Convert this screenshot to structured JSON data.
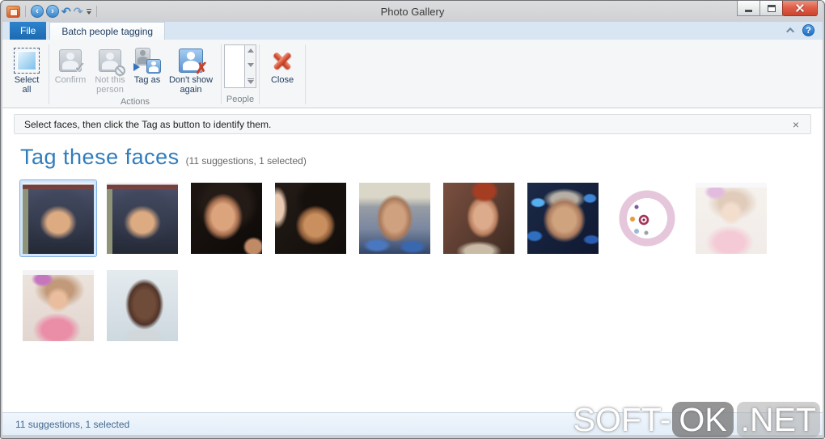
{
  "window": {
    "title": "Photo Gallery"
  },
  "tabs": {
    "file": "File",
    "batch": "Batch people tagging",
    "help_glyph": "?"
  },
  "ribbon": {
    "select_all": "Select all",
    "confirm": "Confirm",
    "not_this_person": "Not this person",
    "tag_as": "Tag as",
    "dont_show_again": "Don't show again",
    "close": "Close",
    "group_actions": "Actions",
    "group_people": "People"
  },
  "infobar": {
    "message": "Select faces, then click the Tag as button to identify them.",
    "close_symbol": "×"
  },
  "heading": {
    "title": "Tag these faces",
    "subtitle": "(11 suggestions, 1 selected)"
  },
  "thumbnails": [
    {
      "variant": "woman-dark-hair-filmstrip",
      "selected": true
    },
    {
      "variant": "woman-dark-hair-filmstrip-2",
      "selected": false
    },
    {
      "variant": "smiling-woman-dark-bg",
      "selected": false
    },
    {
      "variant": "two-women-smiling",
      "selected": false
    },
    {
      "variant": "man-looking-up",
      "selected": false
    },
    {
      "variant": "red-haired-woman",
      "selected": false
    },
    {
      "variant": "older-man-glasses",
      "selected": false
    },
    {
      "variant": "pink-circle-diagram",
      "selected": false
    },
    {
      "variant": "girl-pink-faded",
      "selected": false
    },
    {
      "variant": "girl-pink",
      "selected": false
    },
    {
      "variant": "bald-man-looking-up",
      "selected": false
    }
  ],
  "statusbar": {
    "text": "11 suggestions, 1 selected"
  },
  "watermark": {
    "part1": "SOFT-",
    "part2": "OK",
    "part3": ".NET"
  },
  "qat": {
    "back_glyph": "‹",
    "forward_glyph": "›",
    "undo_glyph": "↶",
    "redo_glyph": "↷"
  }
}
